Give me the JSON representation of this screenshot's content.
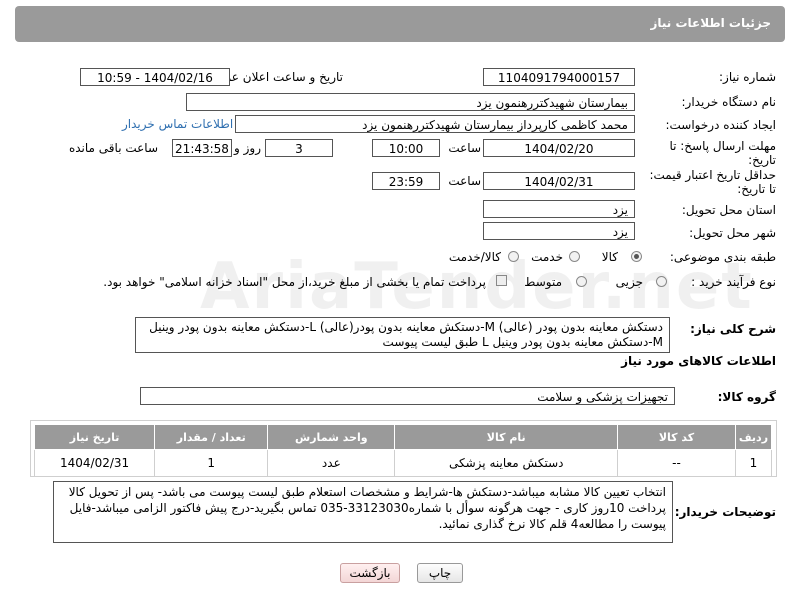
{
  "header": {
    "title": "جزئیات اطلاعات نیاز"
  },
  "watermark": "AriaTender.net",
  "fields": {
    "need_number_label": "شماره نیاز:",
    "need_number": "1104091794000157",
    "public_date_label": "تاریخ و ساعت اعلان عمومی:",
    "public_date": "1404/02/16 - 10:59",
    "buyer_org_label": "نام دستگاه خریدار:",
    "buyer_org": "بیمارستان شهیدکتررهنمون یزد",
    "creator_label": "ایجاد کننده درخواست:",
    "creator": "محمد کاظمی کارپرداز بیمارستان شهیدکتررهنمون یزد",
    "buyer_contact_link": "اطلاعات تماس خریدار",
    "deadline_label_1": "مهلت ارسال پاسخ: تا",
    "deadline_label_2": "تاریخ:",
    "deadline_date": "1404/02/20",
    "time_label": "ساعت",
    "deadline_time": "10:00",
    "days_value": "3",
    "days_label": "روز و",
    "remaining_time": "21:43:58",
    "remaining_label": "ساعت باقی مانده",
    "validity_label_1": "حداقل تاریخ اعتبار قیمت:",
    "validity_label_2": "تا تاریخ:",
    "validity_date": "1404/02/31",
    "validity_time_label": "ساعت",
    "validity_time": "23:59",
    "province_label": "استان محل تحویل:",
    "province": "یزد",
    "city_label": "شهر محل تحویل:",
    "city": "یزد",
    "category_label": "طبقه بندی موضوعی:",
    "category_options": [
      "کالا",
      "خدمت",
      "کالا/خدمت"
    ],
    "process_label": "نوع فرآیند خرید :",
    "process_options": [
      "جزیی",
      "متوسط"
    ],
    "treasury_note": "پرداخت تمام یا بخشی از مبلغ خرید،از محل \"اسناد خزانه اسلامی\" خواهد بود."
  },
  "summary": {
    "label": "شرح کلی نیاز:",
    "text": "دستکش معاینه بدون پودر (عالی) M-دستکش معاینه بدون پودر(عالی) L-دستکش معاینه بدون پودر وینیل M-دستکش معاینه بدون پودر وینیل L طبق لیست پیوست"
  },
  "goods": {
    "section_title": "اطلاعات کالاهای مورد نیاز",
    "group_label": "گروه کالا:",
    "group_value": "تجهیزات پزشکی و سلامت",
    "columns": [
      "ردیف",
      "کد کالا",
      "نام کالا",
      "واحد شمارش",
      "تعداد / مقدار",
      "تاریخ نیاز"
    ],
    "rows": [
      [
        "1",
        "--",
        "دستکش معاینه پزشکی",
        "عدد",
        "1",
        "1404/02/31"
      ]
    ]
  },
  "buyer_notes": {
    "label": "توضیحات خریدار:",
    "text": "انتخاب تعیین کالا مشابه میباشد-دستکش ها-شرایط و مشخصات استعلام طبق لیست پیوست می باشد- پس از تحویل کالا پرداخت 10روز کاری - جهت هرگونه سوأل با شماره33123030-035 تماس بگیرید-درج پیش فاکتور الزامی میباشد-فایل پیوست را مطالعه4 قلم کالا نرخ گذاری نمائید."
  },
  "buttons": {
    "print": "چاپ",
    "back": "بازگشت"
  }
}
